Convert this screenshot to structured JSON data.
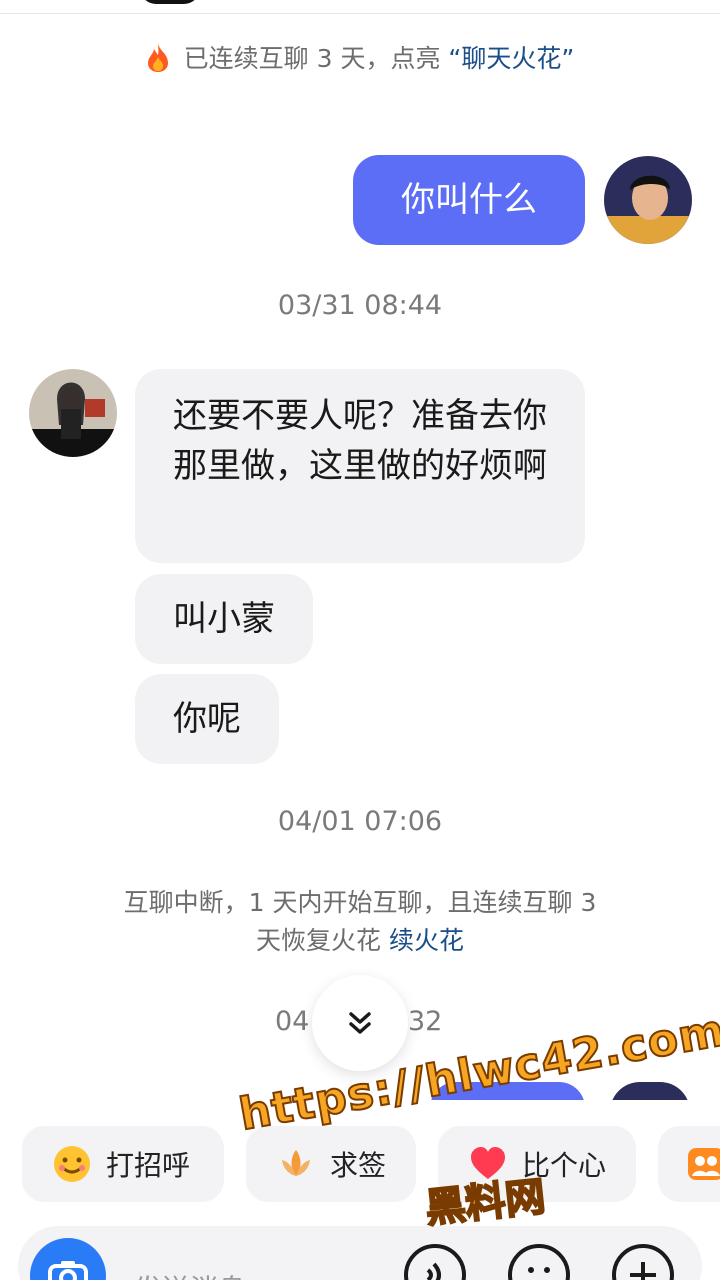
{
  "streak_notice": {
    "text": "已连续互聊 3 天，点亮 ",
    "highlight": "“聊天火花”"
  },
  "messages": {
    "out_1": "你叫什么",
    "time_1": "03/31 08:44",
    "in_1": "还要不要人呢？准备去你那里做，这里做的好烦啊",
    "in_2": "叫小蒙",
    "in_3": "你呢",
    "time_2": "04/01 07:06",
    "time_3_left": "04",
    "time_3_right": "32"
  },
  "interrupt_notice": {
    "text": "互聊中断，1 天内开始互聊，且连续互聊 3 天恢复火花 ",
    "link": "续火花"
  },
  "quick_actions": [
    {
      "label": "打招呼",
      "icon": "smile-emoji-icon"
    },
    {
      "label": "求签",
      "icon": "lotus-icon"
    },
    {
      "label": "比个心",
      "icon": "heart-icon"
    },
    {
      "label": "",
      "icon": "group-icon"
    }
  ],
  "input": {
    "placeholder": "发送消息"
  },
  "watermark": {
    "line1": "https://hlwc42.com",
    "line2": "黑料网"
  },
  "colors": {
    "accent": "#5b6ef5",
    "link": "#1b4f8a",
    "camera": "#2a7cf6"
  }
}
